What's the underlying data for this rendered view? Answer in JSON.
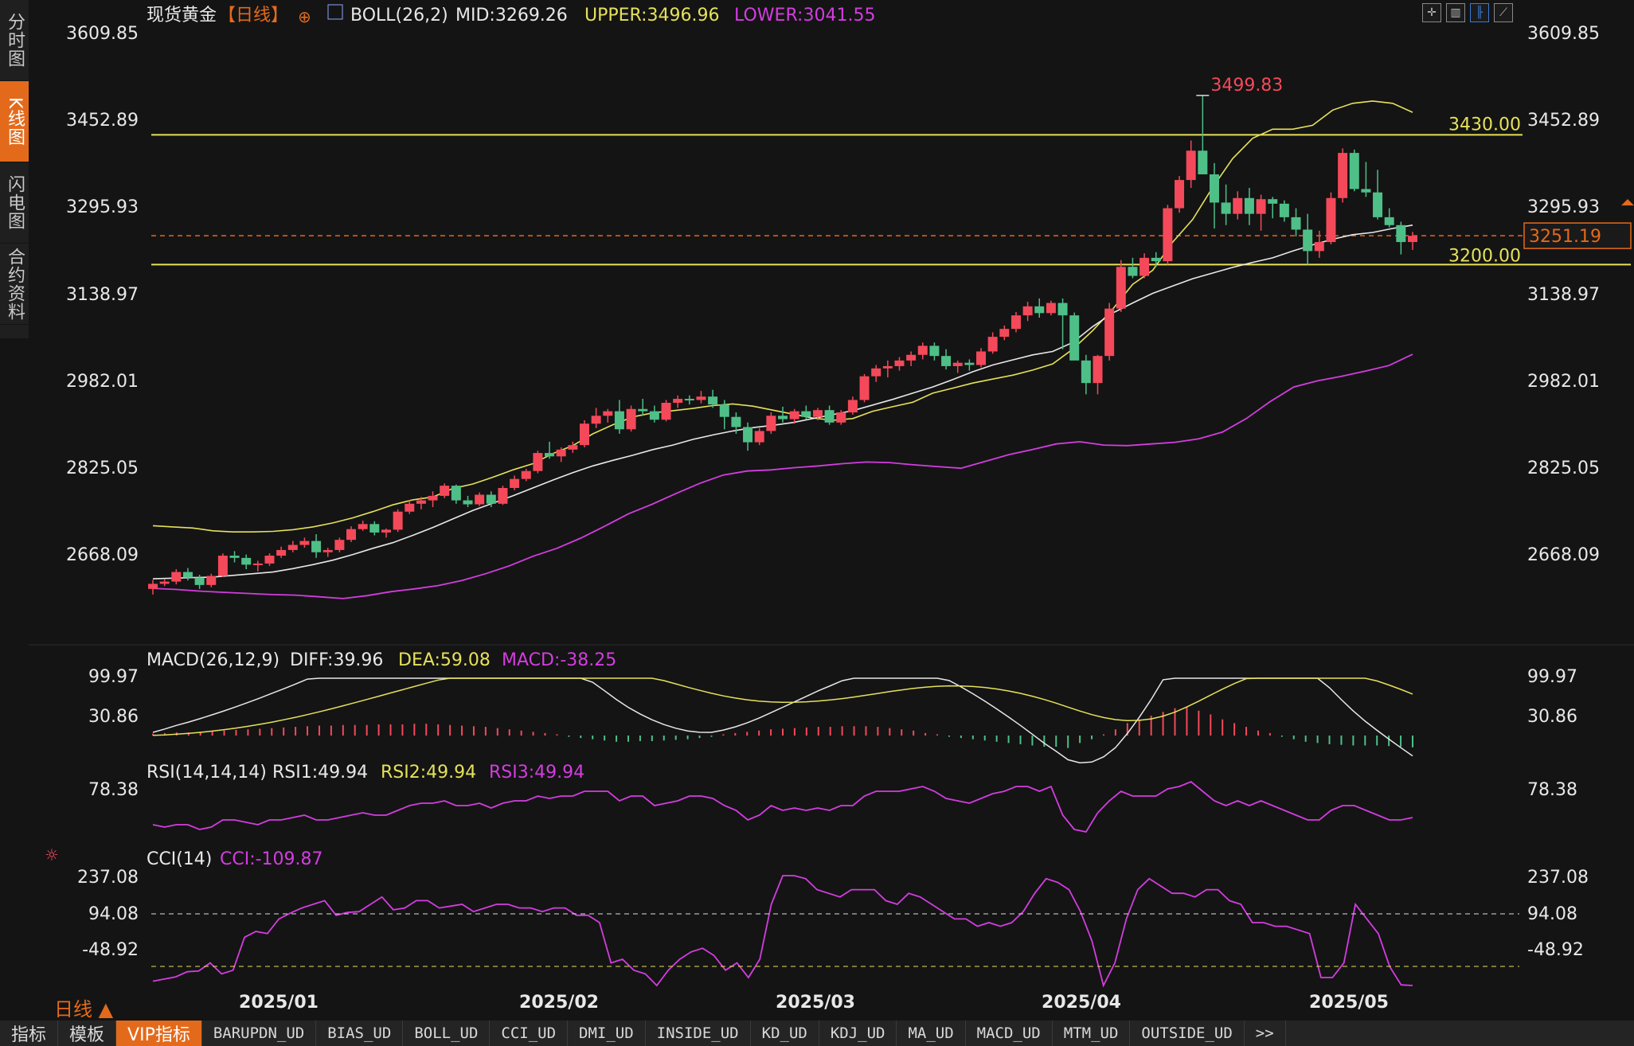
{
  "sidebar": {
    "tabs": [
      {
        "label": "分时图",
        "active": false
      },
      {
        "label": "K线图",
        "active": true
      },
      {
        "label": "闪电图",
        "active": false
      },
      {
        "label": "合约资料",
        "active": false
      }
    ]
  },
  "header": {
    "symbol": "现货黄金",
    "period_tag": "【日线】",
    "boll_label": "BOLL(26,2)",
    "mid": "MID:3269.26",
    "upper": "UPPER:3496.96",
    "lower": "LOWER:3041.55"
  },
  "toolbar_icons": [
    "crosshair-icon",
    "candle-icon",
    "bar-icon",
    "line-icon"
  ],
  "price_axis": {
    "ticks": [
      "3609.85",
      "3452.89",
      "3295.93",
      "3138.97",
      "2982.01",
      "2825.05",
      "2668.09"
    ]
  },
  "lines": {
    "resistance": "3430.00",
    "support": "3200.00",
    "current_price": "3251.19",
    "high_label": "3499.83"
  },
  "macd": {
    "label": "MACD(26,12,9)",
    "diff": "DIFF:39.96",
    "dea": "DEA:59.08",
    "macd": "MACD:-38.25",
    "ticks": [
      "99.97",
      "30.86"
    ]
  },
  "rsi": {
    "label": "RSI(14,14,14)",
    "rsi1": "RSI1:49.94",
    "rsi2": "RSI2:49.94",
    "rsi3": "RSI3:49.94",
    "ticks": [
      "78.38"
    ]
  },
  "cci": {
    "label": "CCI(14)",
    "value": "CCI:-109.87",
    "ticks": [
      "237.08",
      "94.08",
      "-48.92"
    ]
  },
  "x_axis": {
    "labels": [
      "2025/01",
      "2025/02",
      "2025/03",
      "2025/04",
      "2025/05"
    ]
  },
  "period_selector": "日线 ▲",
  "bottom_tabs": [
    {
      "label": "指标",
      "zh": true
    },
    {
      "label": "模板",
      "zh": true
    },
    {
      "label": "VIP指标",
      "zh": true,
      "active": true
    },
    {
      "label": "BARUPDN_UD"
    },
    {
      "label": "BIAS_UD"
    },
    {
      "label": "BOLL_UD"
    },
    {
      "label": "CCI_UD"
    },
    {
      "label": "DMI_UD"
    },
    {
      "label": "INSIDE_UD"
    },
    {
      "label": "KD_UD"
    },
    {
      "label": "KDJ_UD"
    },
    {
      "label": "MA_UD"
    },
    {
      "label": "MACD_UD"
    },
    {
      "label": "MTM_UD"
    },
    {
      "label": "OUTSIDE_UD"
    },
    {
      "label": ">>"
    }
  ],
  "colors": {
    "up": "#f4495a",
    "down": "#4fbf88",
    "yellow": "#e6e15a",
    "magenta": "#d33de0",
    "white": "#e8e8e8",
    "orange": "#e46a1b"
  },
  "chart_data": {
    "type": "candlestick",
    "ohlc": [
      [
        2625,
        2641,
        2615,
        2634
      ],
      [
        2634,
        2642,
        2630,
        2638
      ],
      [
        2638,
        2660,
        2633,
        2655
      ],
      [
        2655,
        2662,
        2640,
        2645
      ],
      [
        2645,
        2650,
        2625,
        2632
      ],
      [
        2632,
        2652,
        2628,
        2648
      ],
      [
        2648,
        2688,
        2646,
        2684
      ],
      [
        2684,
        2692,
        2672,
        2680
      ],
      [
        2680,
        2686,
        2660,
        2668
      ],
      [
        2668,
        2675,
        2656,
        2670
      ],
      [
        2670,
        2688,
        2666,
        2684
      ],
      [
        2684,
        2700,
        2680,
        2694
      ],
      [
        2694,
        2710,
        2690,
        2703
      ],
      [
        2703,
        2716,
        2698,
        2710
      ],
      [
        2710,
        2722,
        2680,
        2690
      ],
      [
        2690,
        2698,
        2682,
        2694
      ],
      [
        2694,
        2716,
        2690,
        2712
      ],
      [
        2712,
        2736,
        2708,
        2731
      ],
      [
        2731,
        2746,
        2728,
        2740
      ],
      [
        2740,
        2745,
        2720,
        2725
      ],
      [
        2725,
        2732,
        2716,
        2730
      ],
      [
        2730,
        2766,
        2726,
        2762
      ],
      [
        2762,
        2782,
        2758,
        2776
      ],
      [
        2776,
        2788,
        2766,
        2782
      ],
      [
        2782,
        2798,
        2770,
        2790
      ],
      [
        2790,
        2812,
        2786,
        2808
      ],
      [
        2808,
        2810,
        2776,
        2782
      ],
      [
        2782,
        2790,
        2770,
        2775
      ],
      [
        2775,
        2796,
        2772,
        2792
      ],
      [
        2792,
        2798,
        2770,
        2776
      ],
      [
        2776,
        2808,
        2774,
        2804
      ],
      [
        2804,
        2826,
        2800,
        2820
      ],
      [
        2820,
        2838,
        2816,
        2834
      ],
      [
        2834,
        2870,
        2830,
        2866
      ],
      [
        2866,
        2886,
        2856,
        2860
      ],
      [
        2860,
        2876,
        2850,
        2872
      ],
      [
        2872,
        2886,
        2866,
        2880
      ],
      [
        2880,
        2924,
        2876,
        2918
      ],
      [
        2918,
        2946,
        2910,
        2932
      ],
      [
        2932,
        2944,
        2920,
        2940
      ],
      [
        2940,
        2960,
        2900,
        2908
      ],
      [
        2908,
        2950,
        2904,
        2944
      ],
      [
        2944,
        2962,
        2932,
        2940
      ],
      [
        2940,
        2950,
        2920,
        2925
      ],
      [
        2925,
        2960,
        2922,
        2955
      ],
      [
        2955,
        2968,
        2946,
        2962
      ],
      [
        2962,
        2968,
        2952,
        2960
      ],
      [
        2960,
        2976,
        2954,
        2966
      ],
      [
        2966,
        2978,
        2946,
        2952
      ],
      [
        2952,
        2960,
        2908,
        2930
      ],
      [
        2930,
        2938,
        2900,
        2912
      ],
      [
        2912,
        2920,
        2870,
        2885
      ],
      [
        2885,
        2910,
        2880,
        2905
      ],
      [
        2905,
        2938,
        2900,
        2932
      ],
      [
        2932,
        2948,
        2920,
        2926
      ],
      [
        2926,
        2944,
        2918,
        2940
      ],
      [
        2940,
        2950,
        2926,
        2930
      ],
      [
        2930,
        2946,
        2924,
        2942
      ],
      [
        2942,
        2950,
        2916,
        2920
      ],
      [
        2920,
        2942,
        2916,
        2938
      ],
      [
        2938,
        2966,
        2934,
        2960
      ],
      [
        2960,
        3006,
        2956,
        3002
      ],
      [
        3002,
        3022,
        2992,
        3016
      ],
      [
        3016,
        3030,
        3000,
        3020
      ],
      [
        3020,
        3036,
        3012,
        3030
      ],
      [
        3030,
        3046,
        3020,
        3040
      ],
      [
        3040,
        3062,
        3032,
        3056
      ],
      [
        3056,
        3062,
        3030,
        3038
      ],
      [
        3038,
        3050,
        3014,
        3020
      ],
      [
        3020,
        3030,
        3008,
        3026
      ],
      [
        3026,
        3032,
        3012,
        3022
      ],
      [
        3022,
        3052,
        3018,
        3046
      ],
      [
        3046,
        3080,
        3042,
        3072
      ],
      [
        3072,
        3092,
        3066,
        3086
      ],
      [
        3086,
        3116,
        3080,
        3110
      ],
      [
        3110,
        3134,
        3100,
        3126
      ],
      [
        3126,
        3140,
        3106,
        3114
      ],
      [
        3114,
        3136,
        3110,
        3132
      ],
      [
        3132,
        3140,
        3050,
        3110
      ],
      [
        3110,
        3115,
        3040,
        3030
      ],
      [
        3030,
        3040,
        2970,
        2990
      ],
      [
        2990,
        3040,
        2970,
        3038
      ],
      [
        3038,
        3132,
        3030,
        3122
      ],
      [
        3122,
        3208,
        3116,
        3196
      ],
      [
        3196,
        3212,
        3176,
        3180
      ],
      [
        3180,
        3220,
        3176,
        3212
      ],
      [
        3212,
        3222,
        3196,
        3206
      ],
      [
        3206,
        3306,
        3200,
        3300
      ],
      [
        3300,
        3357,
        3292,
        3350
      ],
      [
        3350,
        3420,
        3336,
        3402
      ],
      [
        3402,
        3500,
        3380,
        3360
      ],
      [
        3360,
        3380,
        3264,
        3310
      ],
      [
        3310,
        3342,
        3270,
        3290
      ],
      [
        3290,
        3330,
        3280,
        3318
      ],
      [
        3318,
        3336,
        3270,
        3290
      ],
      [
        3290,
        3324,
        3260,
        3316
      ],
      [
        3316,
        3320,
        3282,
        3308
      ],
      [
        3308,
        3314,
        3276,
        3284
      ],
      [
        3284,
        3300,
        3250,
        3262
      ],
      [
        3262,
        3290,
        3200,
        3224
      ],
      [
        3224,
        3260,
        3212,
        3240
      ],
      [
        3240,
        3328,
        3236,
        3318
      ],
      [
        3318,
        3406,
        3310,
        3398
      ],
      [
        3398,
        3404,
        3330,
        3334
      ],
      [
        3334,
        3382,
        3320,
        3328
      ],
      [
        3328,
        3368,
        3280,
        3284
      ],
      [
        3284,
        3300,
        3266,
        3270
      ],
      [
        3270,
        3276,
        3218,
        3240
      ],
      [
        3240,
        3258,
        3226,
        3251
      ]
    ],
    "boll_upper": [
      2737,
      2735,
      2733,
      2728,
      2726,
      2726,
      2727,
      2730,
      2735,
      2742,
      2751,
      2762,
      2774,
      2783,
      2788,
      2803,
      2811,
      2823,
      2836,
      2847,
      2865,
      2879,
      2900,
      2916,
      2930,
      2937,
      2941,
      2945,
      2950,
      2953,
      2949,
      2942,
      2935,
      2928,
      2924,
      2927,
      2940,
      2948,
      2956,
      2972,
      2981,
      2990,
      2997,
      3004,
      3013,
      3024,
      3050,
      3083,
      3121,
      3165,
      3190,
      3240,
      3280,
      3337,
      3388,
      3424,
      3440,
      3440,
      3447,
      3474,
      3486,
      3490,
      3486,
      3470
    ],
    "boll_mid": [
      2643,
      2644,
      2645,
      2646,
      2649,
      2652,
      2655,
      2661,
      2668,
      2676,
      2686,
      2697,
      2707,
      2720,
      2734,
      2749,
      2764,
      2777,
      2790,
      2804,
      2818,
      2831,
      2843,
      2853,
      2862,
      2872,
      2880,
      2890,
      2898,
      2905,
      2911,
      2915,
      2920,
      2927,
      2934,
      2941,
      2951,
      2961,
      2972,
      2983,
      2996,
      3010,
      3022,
      3031,
      3040,
      3046,
      3062,
      3090,
      3114,
      3132,
      3149,
      3162,
      3175,
      3185,
      3195,
      3204,
      3212,
      3224,
      3235,
      3245,
      3253,
      3257,
      3264,
      3270
    ],
    "boll_lower": [
      2626,
      2624,
      2621,
      2619,
      2617,
      2615,
      2614,
      2611,
      2608,
      2613,
      2620,
      2625,
      2631,
      2640,
      2652,
      2666,
      2683,
      2697,
      2715,
      2736,
      2758,
      2775,
      2794,
      2812,
      2827,
      2834,
      2836,
      2840,
      2843,
      2847,
      2850,
      2849,
      2845,
      2842,
      2839,
      2851,
      2863,
      2872,
      2882,
      2886,
      2880,
      2879,
      2882,
      2885,
      2891,
      2903,
      2927,
      2957,
      2983,
      2994,
      3002,
      3011,
      3021,
      3041
    ],
    "macd_hist": [
      3,
      4,
      5,
      5,
      6,
      7,
      8,
      9,
      10,
      11,
      12,
      13,
      14,
      15,
      16,
      16,
      17,
      17,
      17,
      18,
      18,
      18,
      19,
      19,
      18,
      17,
      16,
      15,
      14,
      12,
      10,
      8,
      6,
      4,
      2,
      -2,
      -4,
      -6,
      -8,
      -10,
      -10,
      -9,
      -9,
      -8,
      -7,
      -6,
      -4,
      -2,
      2,
      4,
      6,
      8,
      10,
      11,
      12,
      13,
      14,
      14,
      15,
      15,
      15,
      14,
      12,
      10,
      8,
      4,
      2,
      -2,
      -4,
      -6,
      -8,
      -10,
      -12,
      -14,
      -16,
      -18,
      -18,
      -20,
      -12,
      -6,
      2,
      10,
      20,
      26,
      32,
      38,
      44,
      46,
      40,
      34,
      26,
      20,
      14,
      8,
      4,
      -2,
      -6,
      -10,
      -12,
      -14,
      -15,
      -16,
      -16,
      -16,
      -17,
      -18,
      -19
    ],
    "rsi": [
      58,
      57,
      58,
      58,
      56,
      57,
      60,
      60,
      59,
      58,
      60,
      60,
      61,
      62,
      60,
      60,
      61,
      62,
      63,
      62,
      62,
      64,
      66,
      67,
      67,
      68,
      66,
      66,
      67,
      65,
      67,
      68,
      68,
      70,
      69,
      70,
      70,
      72,
      72,
      72,
      68,
      70,
      70,
      66,
      67,
      68,
      70,
      70,
      69,
      66,
      64,
      60,
      62,
      66,
      64,
      65,
      64,
      65,
      64,
      66,
      66,
      70,
      72,
      72,
      72,
      73,
      74,
      72,
      69,
      68,
      67,
      69,
      71,
      72,
      74,
      74,
      72,
      74,
      62,
      56,
      55,
      63,
      68,
      72,
      70,
      70,
      70,
      73,
      74,
      76,
      72,
      68,
      66,
      68,
      66,
      68,
      66,
      64,
      62,
      60,
      60,
      64,
      66,
      66,
      64,
      62,
      60,
      60,
      61
    ],
    "cci": [
      -90,
      -84,
      -78,
      -64,
      -62,
      -40,
      -70,
      -60,
      30,
      46,
      40,
      80,
      96,
      110,
      120,
      130,
      90,
      98,
      100,
      120,
      140,
      105,
      110,
      130,
      130,
      110,
      115,
      120,
      100,
      110,
      120,
      120,
      110,
      110,
      100,
      110,
      110,
      90,
      90,
      70,
      -40,
      -30,
      -60,
      -70,
      -150,
      -60,
      -30,
      -10,
      0,
      -20,
      -60,
      -40,
      -80,
      -30,
      120,
      200,
      220,
      190,
      160,
      150,
      140,
      160,
      160,
      160,
      130,
      120,
      150,
      140,
      120,
      100,
      80,
      80,
      60,
      70,
      60,
      70,
      100,
      150,
      190,
      180,
      160,
      100,
      20,
      -120,
      -40,
      80,
      160,
      190,
      170,
      150,
      150,
      140,
      160,
      160,
      130,
      120,
      70,
      70,
      60,
      60,
      50,
      40,
      -80,
      -80,
      -40,
      120,
      80,
      40,
      -50,
      -100,
      -110
    ]
  }
}
